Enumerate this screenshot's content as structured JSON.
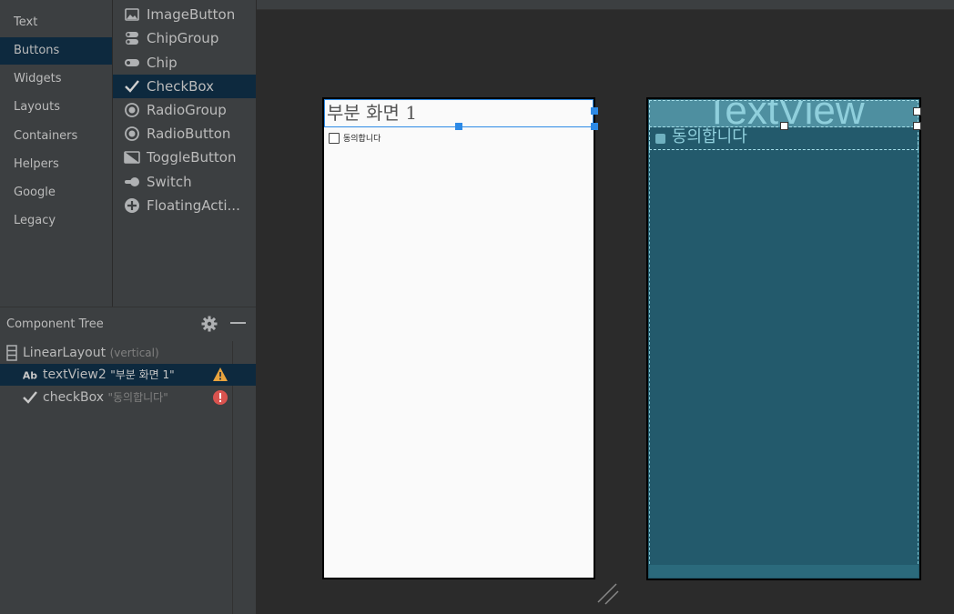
{
  "palette": {
    "categories": [
      "Text",
      "Buttons",
      "Widgets",
      "Layouts",
      "Containers",
      "Helpers",
      "Google",
      "Legacy"
    ],
    "selected_category": "Buttons",
    "items": [
      {
        "label": "ImageButton",
        "icon": "image-icon"
      },
      {
        "label": "ChipGroup",
        "icon": "chip-group-icon"
      },
      {
        "label": "Chip",
        "icon": "chip-icon"
      },
      {
        "label": "CheckBox",
        "icon": "checkmark-icon"
      },
      {
        "label": "RadioGroup",
        "icon": "radio-icon"
      },
      {
        "label": "RadioButton",
        "icon": "radio-icon"
      },
      {
        "label": "ToggleButton",
        "icon": "toggle-icon"
      },
      {
        "label": "Switch",
        "icon": "switch-icon"
      },
      {
        "label": "FloatingActi...",
        "icon": "plus-circle-icon"
      }
    ],
    "selected_item": "CheckBox"
  },
  "component_tree": {
    "title": "Component Tree",
    "rows": [
      {
        "label": "LinearLayout",
        "sub": "(vertical)",
        "icon": "linear-layout-icon",
        "status": ""
      },
      {
        "label": "textView2",
        "sub": "\"부분 화면 1\"",
        "icon": "text-ab-icon",
        "status": "warning"
      },
      {
        "label": "checkBox",
        "sub": "\"동의합니다\"",
        "icon": "checkmark-icon",
        "status": "error"
      }
    ]
  },
  "design": {
    "textview_text": "부분 화면 1",
    "checkbox_text": "동의합니다"
  },
  "blueprint": {
    "textview_text": "TextView",
    "checkbox_text": "동의합니다"
  },
  "colors": {
    "selection": "#0d293e",
    "accent": "#2d8ae6",
    "warning": "#e8a33d",
    "error": "#d9534f",
    "blueprint": "#235a6c"
  }
}
